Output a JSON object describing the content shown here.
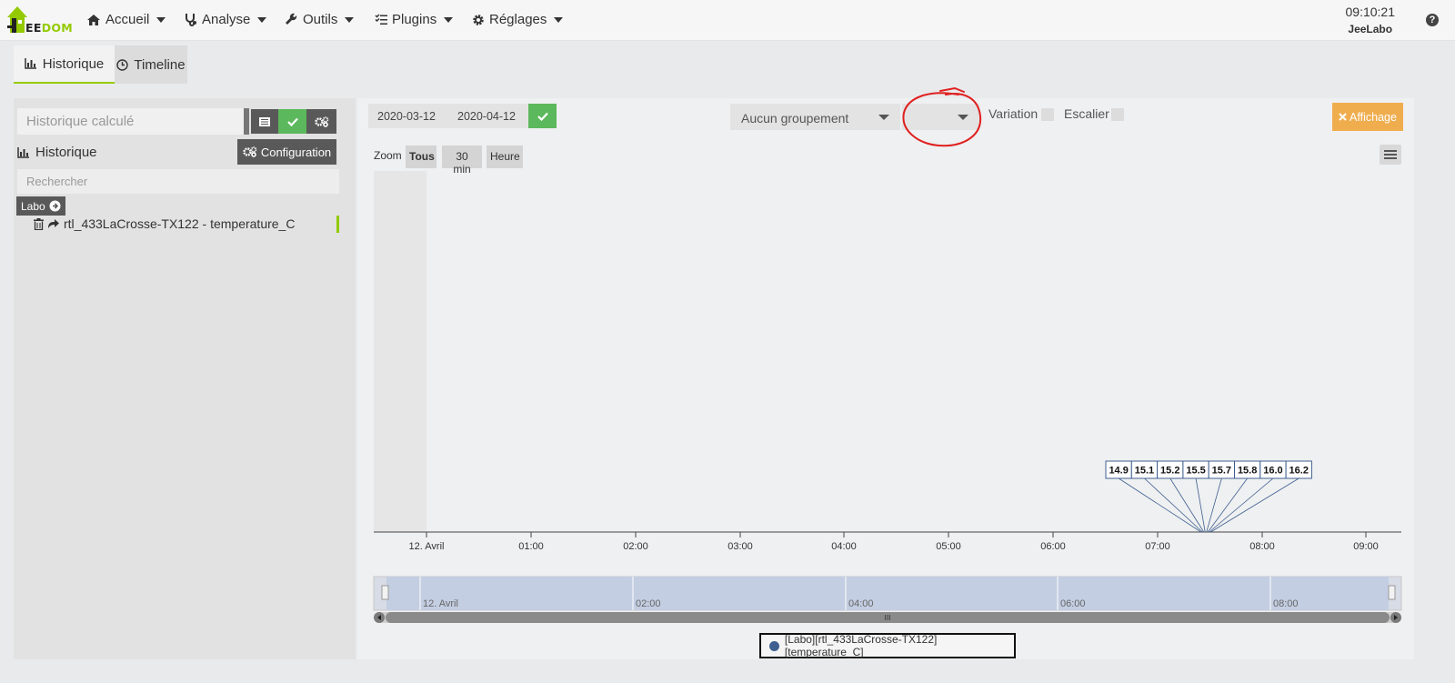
{
  "brand": {
    "logo_prefix": "EE",
    "logo_suffix": "DOM"
  },
  "nav": {
    "items": [
      {
        "label": "Accueil",
        "icon": "home-icon"
      },
      {
        "label": "Analyse",
        "icon": "stethoscope-icon"
      },
      {
        "label": "Outils",
        "icon": "wrench-icon"
      },
      {
        "label": "Plugins",
        "icon": "tasks-icon"
      },
      {
        "label": "Réglages",
        "icon": "cog-icon"
      }
    ],
    "time": "09:10:21",
    "user": "JeeLabo",
    "help": "?"
  },
  "tabs": [
    {
      "label": "Historique",
      "active": true
    },
    {
      "label": "Timeline",
      "active": false
    }
  ],
  "left": {
    "calc_placeholder": "Historique calculé",
    "section_label": "Historique",
    "config_label": "Configuration",
    "search_placeholder": "Rechercher",
    "object_label": "Labo",
    "command_label": "rtl_433LaCrosse-TX122 - temperature_C"
  },
  "toolbar": {
    "date_start": "2020-03-12",
    "date_end": "2020-04-12",
    "grouping": "Aucun groupement",
    "grouping2": "",
    "variation_label": "Variation",
    "escalier_label": "Escalier",
    "affichage_label": "Affichage"
  },
  "zoom": {
    "label": "Zoom",
    "buttons": [
      {
        "label": "Tous",
        "active": true
      },
      {
        "label": "30 min",
        "active": false
      },
      {
        "label": "Heure",
        "active": false
      }
    ]
  },
  "chart_data": {
    "type": "line",
    "x_ticks": [
      "12. Avril",
      "01:00",
      "02:00",
      "03:00",
      "04:00",
      "05:00",
      "06:00",
      "07:00",
      "08:00",
      "09:00"
    ],
    "navigator_ticks": [
      "12. Avril",
      "02:00",
      "04:00",
      "06:00",
      "08:00"
    ],
    "data_labels": [
      "14.9",
      "15.1",
      "15.2",
      "15.5",
      "15.7",
      "15.8",
      "16.0",
      "16.2"
    ],
    "legend": "[Labo][rtl_433LaCrosse-TX122][temperature_C]",
    "series_color": "#3f5f91",
    "navigator_handle": "III"
  }
}
